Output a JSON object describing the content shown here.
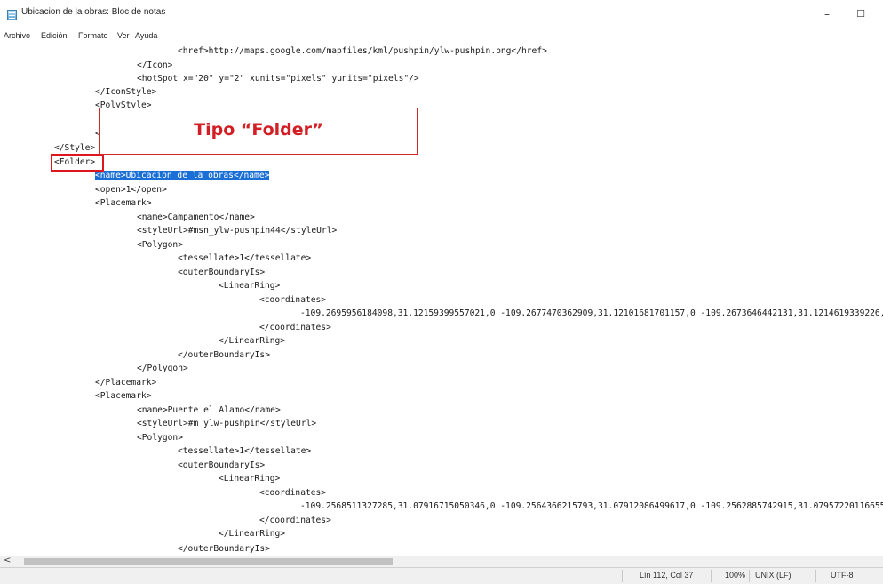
{
  "window": {
    "title": "Ubicacion de la obras: Bloc de notas",
    "minimize": "–",
    "maximize": "☐"
  },
  "menu": [
    "Archivo",
    "Edición",
    "Formato",
    "Ver",
    "Ayuda"
  ],
  "editor": {
    "lines": [
      "<href>http://maps.google.com/mapfiles/kml/pushpin/ylw-pushpin.png</href>",
      "</Icon>",
      "<hotSpot x=\"20\" y=\"2\" xunits=\"pixels\" yunits=\"pixels\"/>",
      "</IconStyle>",
      "<PolyStyle>",
      "<",
      "</Style>",
      "<Folder>",
      "<name>Ubicacion de la obras</name>",
      "<open>1</open>",
      "<Placemark>",
      "<name>Campamento</name>",
      "<styleUrl>#msn_ylw-pushpin44</styleUrl>",
      "<Polygon>",
      "<tessellate>1</tessellate>",
      "<outerBoundaryIs>",
      "<LinearRing>",
      "<coordinates>",
      "-109.2695956184098,31.12159399557021,0 -109.2677470362909,31.12101681701157,0 -109.2673646442131,31.1214619339226,0 -1",
      "</coordinates>",
      "</LinearRing>",
      "</outerBoundaryIs>",
      "</Polygon>",
      "</Placemark>",
      "<Placemark>",
      "<name>Puente el Alamo</name>",
      "<styleUrl>#m_ylw-pushpin</styleUrl>",
      "<Polygon>",
      "<tessellate>1</tessellate>",
      "<outerBoundaryIs>",
      "<LinearRing>",
      "<coordinates>",
      "-109.2568511327285,31.07916715050346,0 -109.2564366215793,31.07912086499617,0 -109.2562885742915,31.07957220116655,0 -",
      "</coordinates>",
      "</LinearRing>",
      "</outerBoundaryIs>"
    ]
  },
  "annotation": {
    "callout_text": "Tipo “Folder”",
    "highlight_color": "#e0161e",
    "selection_color": "#1a6fd6"
  },
  "scrollbar": {
    "left_arrow": "<"
  },
  "status": {
    "position": "Lín 112, Col 37",
    "zoom": "100%",
    "line_ending": "UNIX (LF)",
    "encoding": "UTF-8"
  }
}
